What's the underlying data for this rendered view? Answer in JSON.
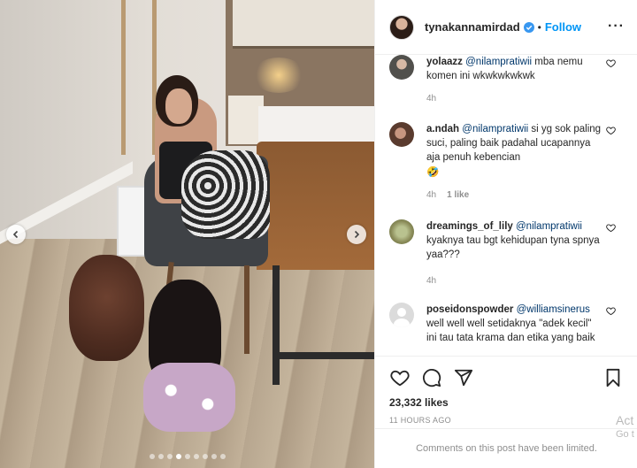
{
  "post": {
    "carousel": {
      "count": 9,
      "active_index": 3
    }
  },
  "header": {
    "username": "tynakannamirdad",
    "separator": "•",
    "follow_label": "Follow",
    "more_label": "···"
  },
  "comments": [
    {
      "username": "yolaazz",
      "mention": "@nilampratiwii",
      "text": " mba nemu komen ini wkwkwkwkwk",
      "time": "4h",
      "likes": ""
    },
    {
      "username": "a.ndah",
      "mention": "@nilampratiwii",
      "text": " si yg sok paling suci, paling baik padahal ucapannya aja penuh kebencian",
      "emoji": "🤣",
      "time": "4h",
      "likes": "1 like"
    },
    {
      "username": "dreamings_of_lily",
      "mention": "@nilampratiwii",
      "text": " kyaknya tau bgt kehidupan tyna spnya yaa???",
      "time": "4h",
      "likes": ""
    },
    {
      "username": "poseidonspowder",
      "mention": "@williamsinerus",
      "text": " well well well setidaknya \"adek kecil\" ini tau tata krama dan etika yang baik",
      "time": "",
      "likes": ""
    }
  ],
  "actions": {
    "likes_text": "23,332 likes",
    "timestamp": "11 HOURS AGO",
    "comments_limited": "Comments on this post have been limited."
  },
  "watermark": {
    "line1": "Act",
    "line2": "Go t"
  },
  "icons": [
    "heart-icon",
    "comment-icon",
    "share-icon",
    "bookmark-icon",
    "chevron-left-icon",
    "chevron-right-icon",
    "verified-badge-icon"
  ],
  "colors": {
    "link_blue": "#0095f6",
    "mention_blue": "#00376b",
    "muted_gray": "#8e8e8e",
    "text": "#262626"
  }
}
